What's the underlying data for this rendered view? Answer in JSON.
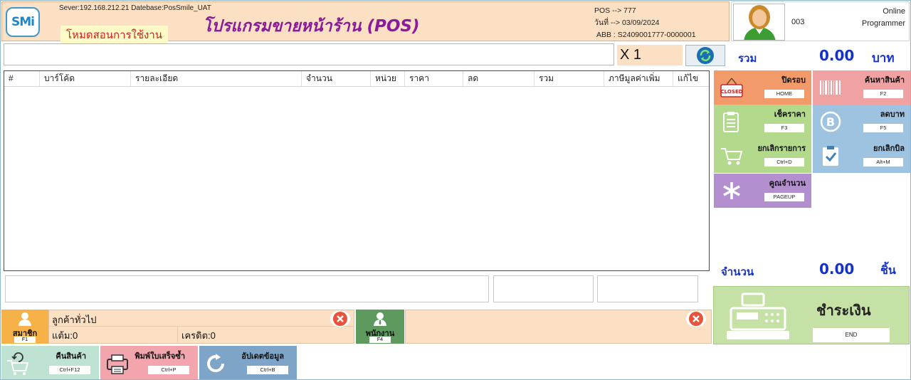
{
  "header": {
    "logo_text": "SMi",
    "server_info": "Sever:192.168.212.21 Datebase:PosSmile_UAT",
    "mode_label": "โหมดสอนการใช้งาน",
    "title": "โปรแกรมขายหน้าร้าน (POS)",
    "pos_line": "POS --> 777",
    "date_line": "วันที่ --> 03/09/2024",
    "abb_line": "ABB : S2409001777-0000001"
  },
  "user": {
    "code": "003",
    "status": "Online",
    "role": "Programmer"
  },
  "entry": {
    "barcode_value": "",
    "qty_multiplier": "X 1"
  },
  "summary": {
    "total_label": "รวม",
    "total_value": "0.00",
    "total_unit": "บาท",
    "count_label": "จำนวน",
    "count_value": "0.00",
    "count_unit": "ชิ้น"
  },
  "table": {
    "columns": [
      "#",
      "บาร์โค้ด",
      "รายละเอียด",
      "จำนวน",
      "หน่วย",
      "ราคา",
      "ลด",
      "รวม",
      "ภาษีมูลค่าเพิ่ม",
      "แก้ไข"
    ]
  },
  "functions": [
    {
      "label": "ปิดรอบ",
      "key": "HOME",
      "color": "#f39a6a"
    },
    {
      "label": "ค้นหาสินค้า",
      "key": "F2",
      "color": "#f0a2a2"
    },
    {
      "label": "เช็คราคา",
      "key": "F3",
      "color": "#b3d98c"
    },
    {
      "label": "ลดบาท",
      "key": "F5",
      "color": "#9ec3e0"
    },
    {
      "label": "ยกเลิกรายการ",
      "key": "Ctrl+D",
      "color": "#b3d98c"
    },
    {
      "label": "ยกเลิกบิล",
      "key": "Alt+M",
      "color": "#9ec3e0"
    },
    {
      "label": "คูณจำนวน",
      "key": "PAGEUP",
      "color": "#b38fd0"
    }
  ],
  "closed_sign": "CLOSED",
  "pay": {
    "label": "ชำระเงิน",
    "key": "END"
  },
  "member": {
    "button_label": "สมาชิก",
    "button_key": "F1",
    "customer_name": "ลูกค้าทั่วไป",
    "points": "แต้ม:0",
    "credit": "เครดิต:0"
  },
  "staff": {
    "button_label": "พนักงาน",
    "button_key": "F4"
  },
  "bottom_buttons": [
    {
      "label": "คืนสินค้า",
      "key": "Ctrl+F12",
      "color": "#bfe3d3"
    },
    {
      "label": "พิมพ์ใบเสร็จซ้ำ",
      "key": "Ctrl+P",
      "color": "#f3a5ad"
    },
    {
      "label": "อัปเดตข้อมูล",
      "key": "Ctrl+B",
      "color": "#7ea5c8"
    }
  ]
}
